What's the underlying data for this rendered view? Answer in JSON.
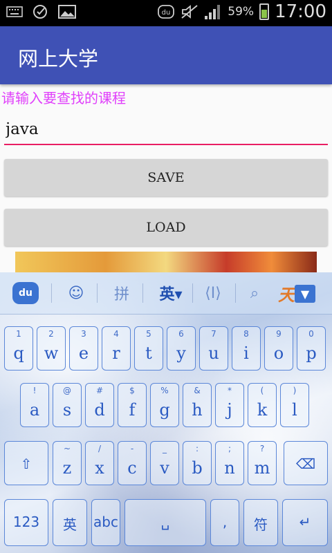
{
  "status_bar": {
    "left_icons": [
      "keyboard-icon",
      "messaging-icon",
      "image-icon"
    ],
    "right_icons": [
      "du-icon",
      "mute-icon",
      "signal-icon"
    ],
    "battery_percent": "59%",
    "battery_level": 0.59,
    "time": "17:00"
  },
  "app_bar": {
    "title": "网上大学"
  },
  "form": {
    "prompt": "请输入要查找的课程",
    "query_value": "java",
    "save_label": "SAVE",
    "load_label": "LOAD"
  },
  "keyboard": {
    "toolbar": {
      "logo": "du",
      "emoji": "☺",
      "pinyin": "拼",
      "english": "英▾",
      "cursor": "⟨I⟩",
      "search": "⌕",
      "brand": "天",
      "collapse": "▼"
    },
    "row1": [
      {
        "main": "q",
        "sub": "1"
      },
      {
        "main": "w",
        "sub": "2"
      },
      {
        "main": "e",
        "sub": "3"
      },
      {
        "main": "r",
        "sub": "4"
      },
      {
        "main": "t",
        "sub": "5"
      },
      {
        "main": "y",
        "sub": "6"
      },
      {
        "main": "u",
        "sub": "7"
      },
      {
        "main": "i",
        "sub": "8"
      },
      {
        "main": "o",
        "sub": "9"
      },
      {
        "main": "p",
        "sub": "0"
      }
    ],
    "row2": [
      {
        "main": "a",
        "sub": "!"
      },
      {
        "main": "s",
        "sub": "@"
      },
      {
        "main": "d",
        "sub": "#"
      },
      {
        "main": "f",
        "sub": "$"
      },
      {
        "main": "g",
        "sub": "%"
      },
      {
        "main": "h",
        "sub": "&"
      },
      {
        "main": "j",
        "sub": "*"
      },
      {
        "main": "k",
        "sub": "("
      },
      {
        "main": "l",
        "sub": ")"
      }
    ],
    "row3": [
      {
        "main": "z",
        "sub": "~"
      },
      {
        "main": "x",
        "sub": "/"
      },
      {
        "main": "c",
        "sub": "-"
      },
      {
        "main": "v",
        "sub": "_"
      },
      {
        "main": "b",
        "sub": ":"
      },
      {
        "main": "n",
        "sub": ";"
      },
      {
        "main": "m",
        "sub": "?"
      }
    ],
    "row3_shift": "⇧",
    "row3_backspace": "⌫",
    "row4": {
      "num": "123",
      "ying": "英",
      "abc": "abc",
      "space": "␣",
      "mic": "🎤",
      "comma": ",",
      "fu": "符",
      "enter": "↵"
    }
  }
}
